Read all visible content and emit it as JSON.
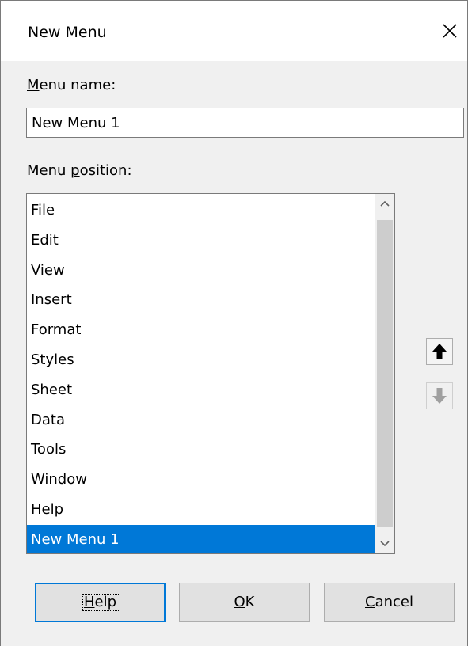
{
  "dialog": {
    "title": "New Menu",
    "close_icon": "close-icon"
  },
  "menu_name": {
    "label_accel": "M",
    "label_rest": "enu name:",
    "value": "New Menu 1"
  },
  "menu_position": {
    "label_pre": "Menu ",
    "label_accel": "p",
    "label_rest": "osition:",
    "items": [
      "File",
      "Edit",
      "View",
      "Insert",
      "Format",
      "Styles",
      "Sheet",
      "Data",
      "Tools",
      "Window",
      "Help",
      "New Menu 1"
    ],
    "selected_index": 11
  },
  "move_buttons": {
    "up_icon": "arrow-up-icon",
    "down_icon": "arrow-down-icon"
  },
  "buttons": {
    "help": {
      "accel": "H",
      "rest": "elp"
    },
    "ok": {
      "accel": "O",
      "rest": "K"
    },
    "cancel": {
      "accel": "C",
      "rest": "ancel"
    }
  },
  "colors": {
    "selection": "#0078d7",
    "focus_border": "#0078d7",
    "dialog_bg": "#f0f0f0"
  }
}
